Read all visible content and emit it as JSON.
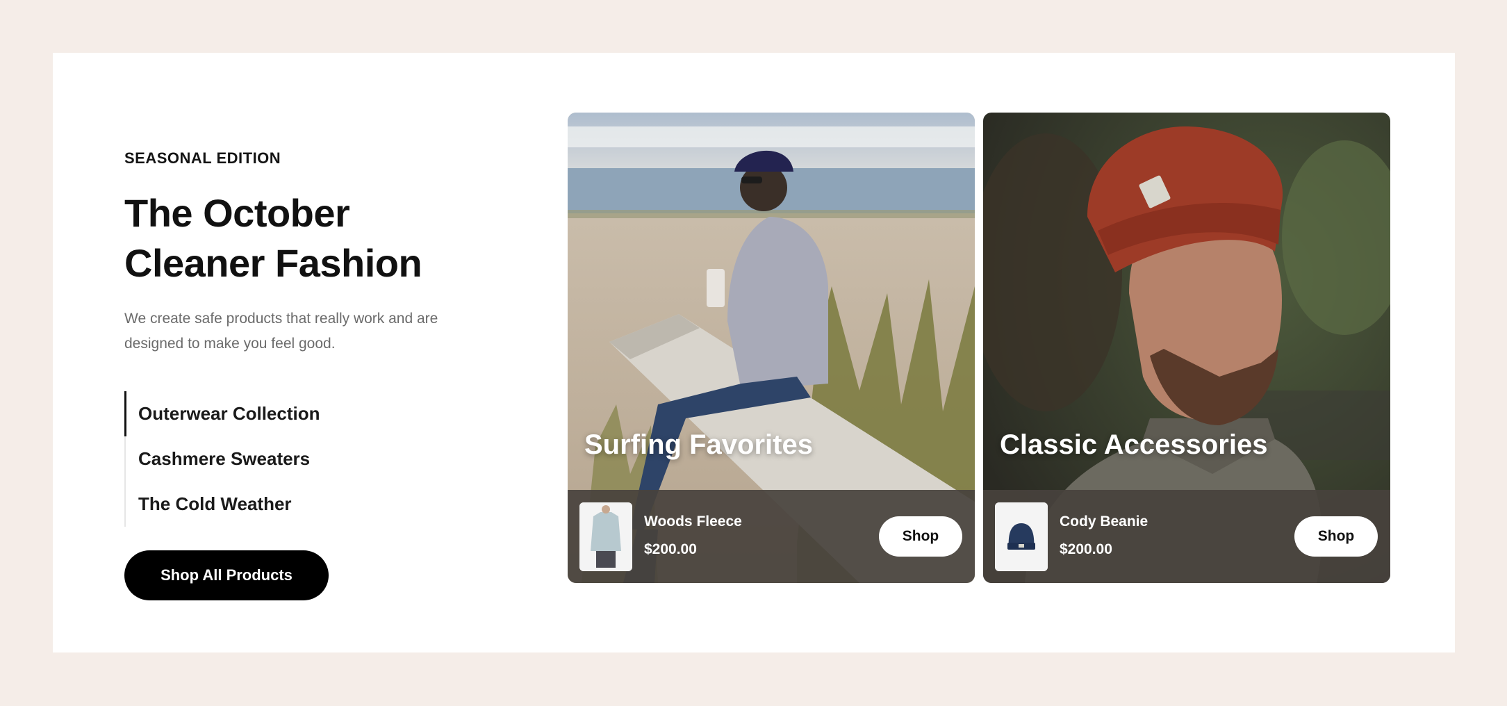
{
  "hero": {
    "eyebrow": "SEASONAL EDITION",
    "title_line1": "The October",
    "title_line2": "Cleaner Fashion",
    "description": "We create safe products that really work and are designed to make you feel good.",
    "collections": [
      {
        "label": "Outerwear Collection",
        "active": true
      },
      {
        "label": "Cashmere Sweaters",
        "active": false
      },
      {
        "label": "The Cold Weather",
        "active": false
      }
    ],
    "cta_label": "Shop All Products"
  },
  "cards": [
    {
      "title": "Surfing Favorites",
      "product_name": "Woods Fleece",
      "price": "$200.00",
      "shop_label": "Shop"
    },
    {
      "title": "Classic Accessories",
      "product_name": "Cody Beanie",
      "price": "$200.00",
      "shop_label": "Shop"
    }
  ],
  "colors": {
    "page_background": "#f5ede8",
    "panel_background": "#ffffff",
    "cta_background": "#000000",
    "card_bar": "#48423d"
  }
}
